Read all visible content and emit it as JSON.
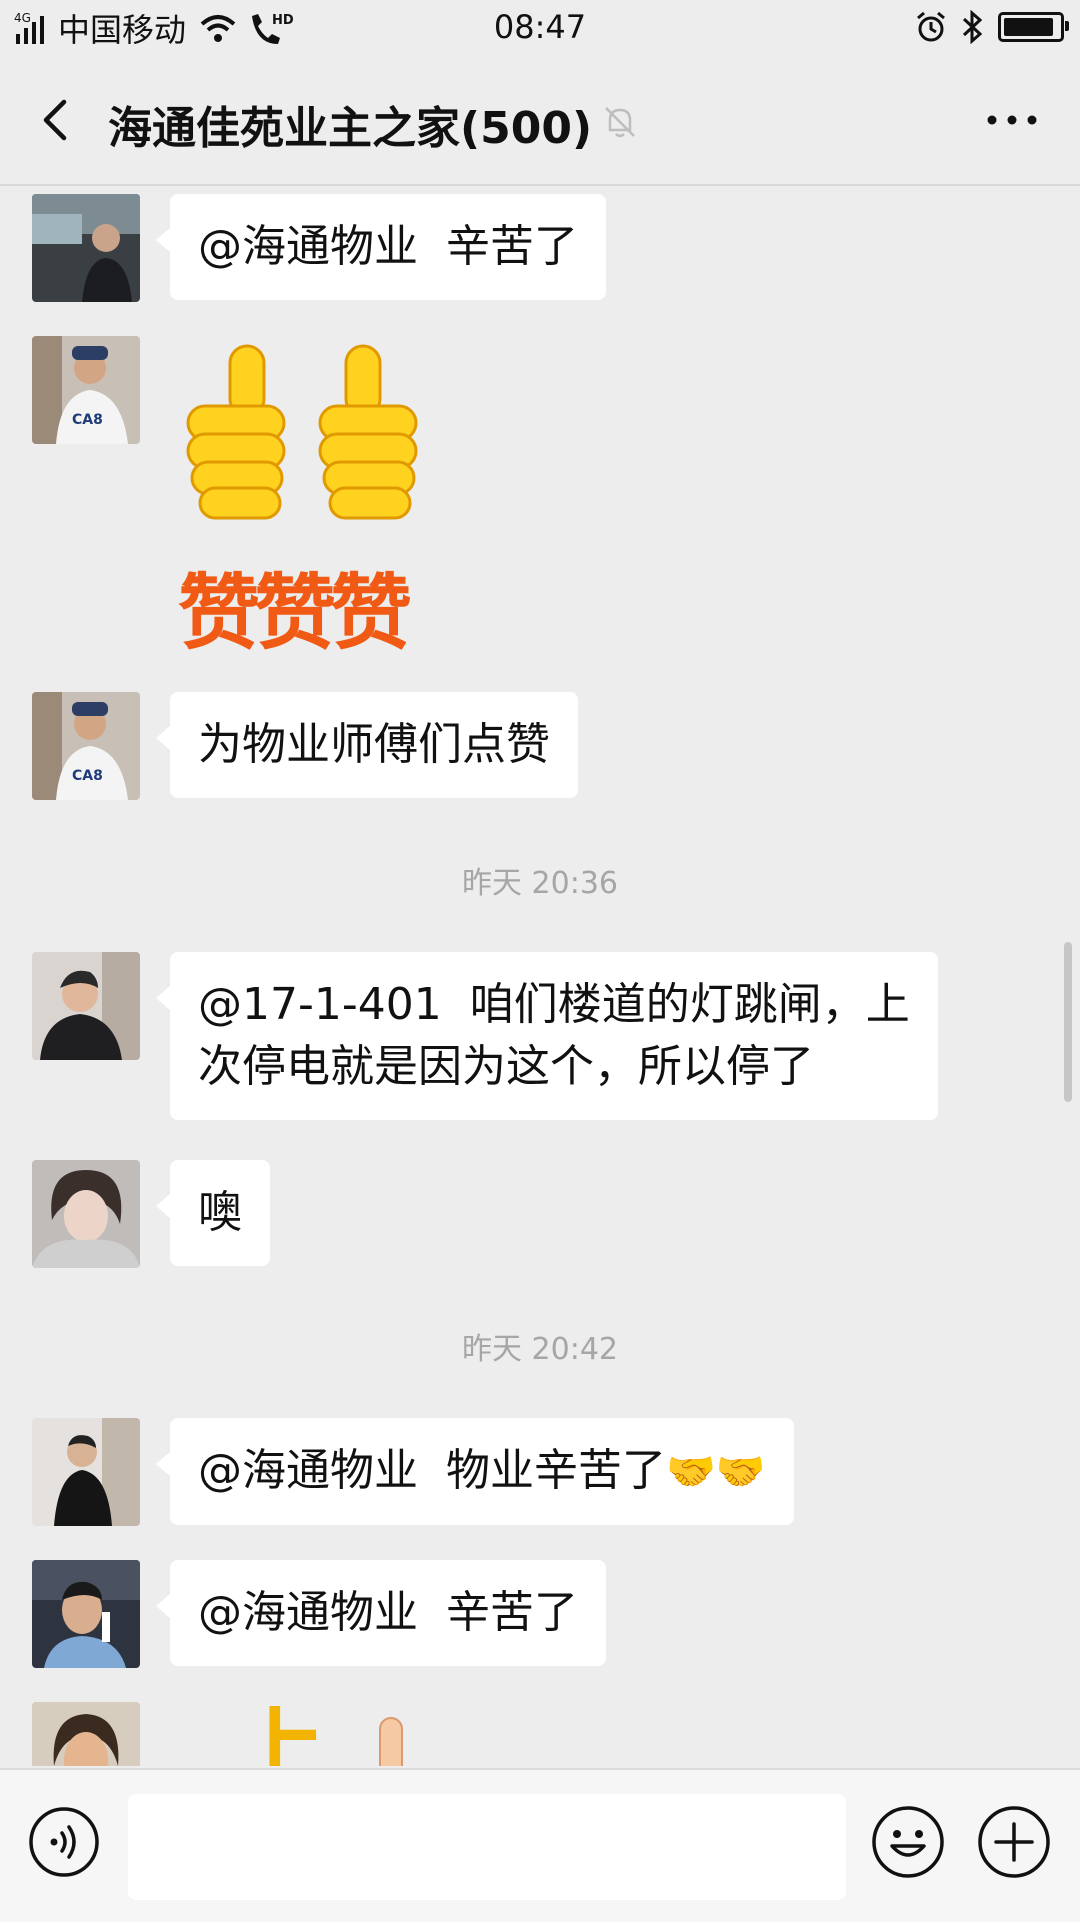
{
  "status_bar": {
    "network": "4G",
    "carrier": "中国移动",
    "hd_label": "HD",
    "time": "08:47",
    "battery_level": 0.9
  },
  "header": {
    "title": "海通佳苑业主之家(500)",
    "back_icon": "chevron-left-icon",
    "mute_icon": "bell-off-icon",
    "more_icon": "more-horizontal-icon"
  },
  "messages": [
    {
      "type": "text",
      "text": "@海通物业  辛苦了"
    },
    {
      "type": "sticker",
      "text": "赞赞赞"
    },
    {
      "type": "text",
      "text": "为物业师傅们点赞"
    },
    {
      "type": "time",
      "text": "昨天 20:36"
    },
    {
      "type": "text",
      "text": "@17-1-401  咱们楼道的灯跳闸，上\n次停电就是因为这个，所以停了"
    },
    {
      "type": "text",
      "text": "噢"
    },
    {
      "type": "time",
      "text": "昨天 20:42"
    },
    {
      "type": "text",
      "text": "@海通物业  物业辛苦了",
      "emoji": "🤝🤝"
    },
    {
      "type": "text",
      "text": "@海通物业  辛苦了"
    },
    {
      "type": "sticker-partial",
      "text": "上"
    }
  ],
  "input_bar": {
    "voice_icon": "voice-icon",
    "emoji_icon": "smile-icon",
    "plus_icon": "plus-circle-icon",
    "input_value": ""
  }
}
